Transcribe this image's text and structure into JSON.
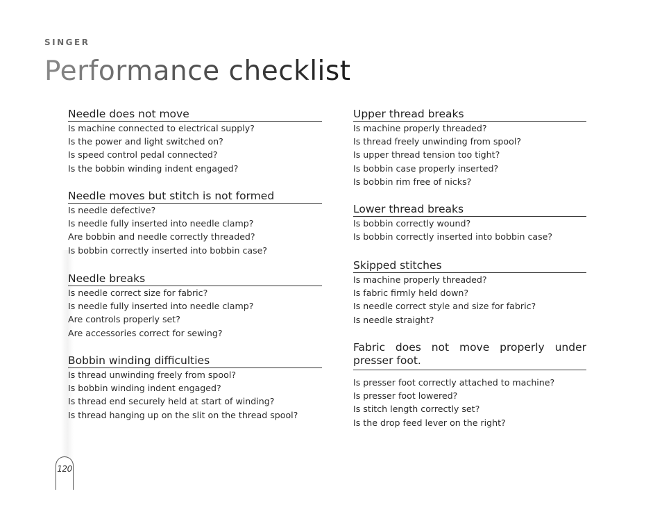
{
  "header": {
    "brand": "SINGER",
    "title": "Performance checklist"
  },
  "left_column": [
    {
      "heading": "Needle does not move",
      "items": [
        "Is machine connected to electrical supply?",
        "Is the power and light switched on?",
        "Is speed control pedal connected?",
        "Is the bobbin winding indent engaged?"
      ]
    },
    {
      "heading": "Needle moves but stitch is not formed",
      "items": [
        "Is needle defective?",
        "Is needle fully inserted into needle clamp?",
        "Are bobbin and needle correctly threaded?",
        "Is bobbin correctly inserted into bobbin case?"
      ]
    },
    {
      "heading": "Needle breaks",
      "items": [
        "Is needle correct size for fabric?",
        "Is needle fully inserted into needle clamp?",
        "Are controls properly set?",
        "Are accessories correct for sewing?"
      ]
    },
    {
      "heading": "Bobbin winding difficulties",
      "items": [
        "Is thread unwinding freely from spool?",
        "Is bobbin winding indent engaged?",
        "Is thread end securely held at start of winding?",
        "Is thread hanging up on the slit on the thread spool?"
      ]
    }
  ],
  "right_column": [
    {
      "heading": "Upper thread breaks",
      "items": [
        "Is machine properly threaded?",
        "Is thread freely unwinding from spool?",
        "Is upper thread tension too tight?",
        "Is bobbin case properly inserted?",
        "Is bobbin rim free of nicks?"
      ]
    },
    {
      "heading": "Lower thread breaks",
      "items": [
        "Is bobbin correctly wound?",
        "Is bobbin correctly inserted into bobbin case?"
      ]
    },
    {
      "heading": "Skipped stitches",
      "items": [
        "Is machine properly threaded?",
        "Is fabric firmly held down?",
        "Is needle correct style and size for fabric?",
        "Is needle straight?"
      ]
    },
    {
      "heading": "Fabric does not move properly under presser foot.",
      "items": [
        "Is presser foot correctly attached to machine?",
        "Is presser foot lowered?",
        "Is stitch length correctly set?",
        "Is the drop feed lever on the right?"
      ]
    }
  ],
  "footer": {
    "page_number": "120"
  }
}
